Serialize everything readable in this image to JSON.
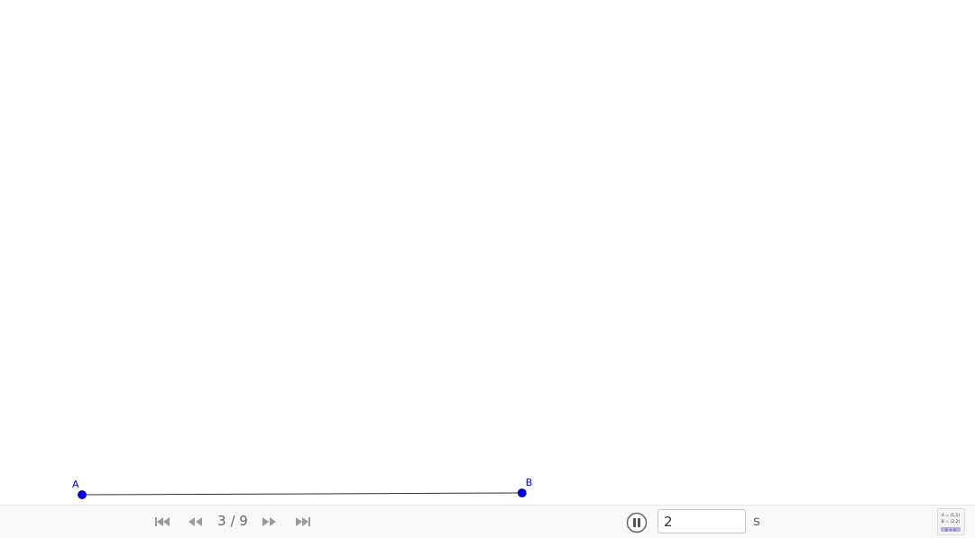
{
  "construction": {
    "points": [
      {
        "name": "A",
        "x": 0,
        "y": 0
      },
      {
        "name": "B",
        "x": 9,
        "y": 0
      }
    ],
    "segment": {
      "from": "A",
      "to": "B"
    },
    "point_color": "#0000ff",
    "segment_color": "#333333"
  },
  "toolbar": {
    "first_step_icon": "skip-to-start-icon",
    "previous_step_icon": "rewind-icon",
    "step_counter": "3 / 9",
    "next_step_icon": "fast-forward-icon",
    "last_step_icon": "skip-to-end-icon",
    "play_state_icon": "pause-icon",
    "speed_value": "2",
    "speed_unit": "s",
    "algebra_icon": "algebra-view-icon",
    "algebra_icon_lines": [
      "A = (1,1)",
      "B = (2,2)",
      "y = x"
    ]
  }
}
